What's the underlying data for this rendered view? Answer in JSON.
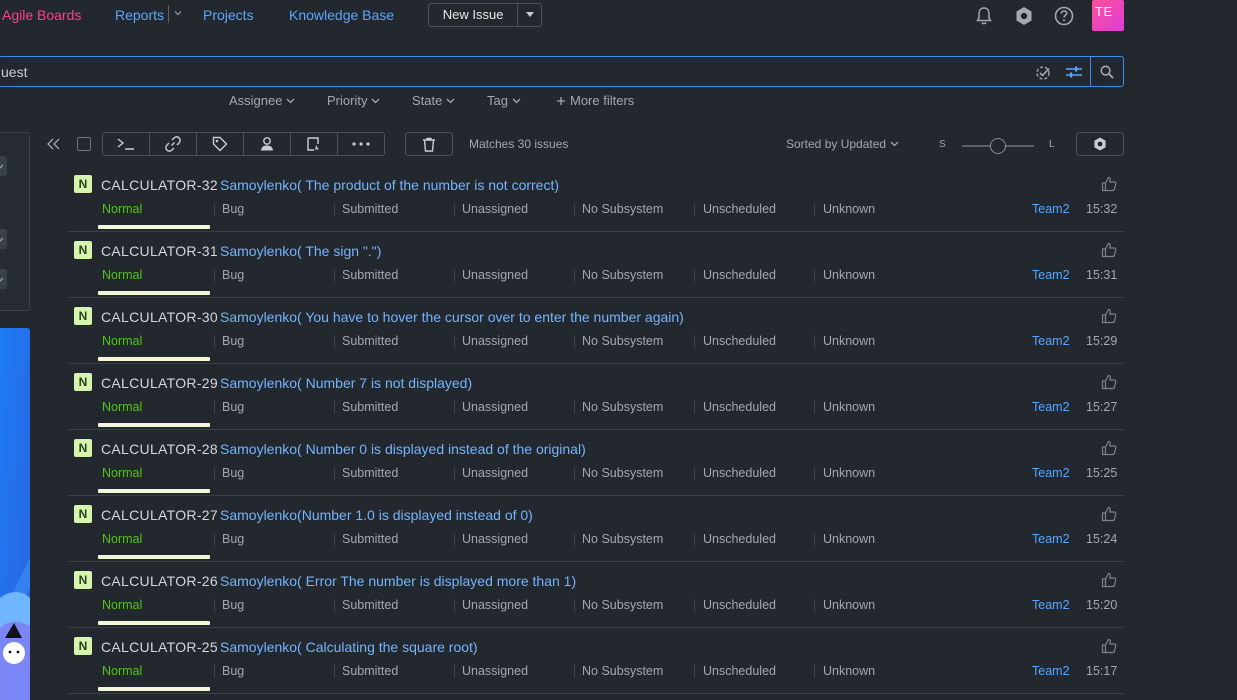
{
  "nav": {
    "agile_boards": "Agile Boards",
    "reports": "Reports",
    "projects": "Projects",
    "knowledge_base": "Knowledge Base",
    "new_issue": "New Issue",
    "avatar_initials": "TE"
  },
  "search": {
    "query_text": "uest"
  },
  "filters": {
    "assignee": "Assignee",
    "priority": "Priority",
    "state": "State",
    "tag": "Tag",
    "more": "More filters"
  },
  "toolbar": {
    "matches": "Matches 30 issues",
    "sorted": "Sorted by Updated",
    "size_small": "S",
    "size_large": "L"
  },
  "colors": {
    "accent_blue": "#58a7ff",
    "active_nav": "#ff3f8a",
    "priority_normal": "#52c41a",
    "badge_bg": "#d8f5b0"
  },
  "issues": [
    {
      "badge": "N",
      "id": "CALCULATOR-32",
      "summary": "Samoylenko( The product of the number is not correct)",
      "priority": "Normal",
      "type": "Bug",
      "state": "Submitted",
      "assignee": "Unassigned",
      "subsystem": "No Subsystem",
      "fix_version": "Unscheduled",
      "affected": "Unknown",
      "team": "Team2",
      "time": "15:32"
    },
    {
      "badge": "N",
      "id": "CALCULATOR-31",
      "summary": "Samoylenko( The sign \".\")",
      "priority": "Normal",
      "type": "Bug",
      "state": "Submitted",
      "assignee": "Unassigned",
      "subsystem": "No Subsystem",
      "fix_version": "Unscheduled",
      "affected": "Unknown",
      "team": "Team2",
      "time": "15:31"
    },
    {
      "badge": "N",
      "id": "CALCULATOR-30",
      "summary": "Samoylenko( You have to hover the cursor over to enter the number again)",
      "priority": "Normal",
      "type": "Bug",
      "state": "Submitted",
      "assignee": "Unassigned",
      "subsystem": "No Subsystem",
      "fix_version": "Unscheduled",
      "affected": "Unknown",
      "team": "Team2",
      "time": "15:29"
    },
    {
      "badge": "N",
      "id": "CALCULATOR-29",
      "summary": "Samoylenko( Number 7 is not displayed)",
      "priority": "Normal",
      "type": "Bug",
      "state": "Submitted",
      "assignee": "Unassigned",
      "subsystem": "No Subsystem",
      "fix_version": "Unscheduled",
      "affected": "Unknown",
      "team": "Team2",
      "time": "15:27"
    },
    {
      "badge": "N",
      "id": "CALCULATOR-28",
      "summary": "Samoylenko( Number 0 is displayed instead of the original)",
      "priority": "Normal",
      "type": "Bug",
      "state": "Submitted",
      "assignee": "Unassigned",
      "subsystem": "No Subsystem",
      "fix_version": "Unscheduled",
      "affected": "Unknown",
      "team": "Team2",
      "time": "15:25"
    },
    {
      "badge": "N",
      "id": "CALCULATOR-27",
      "summary": "Samoylenko(Number 1.0 is displayed instead of 0)",
      "priority": "Normal",
      "type": "Bug",
      "state": "Submitted",
      "assignee": "Unassigned",
      "subsystem": "No Subsystem",
      "fix_version": "Unscheduled",
      "affected": "Unknown",
      "team": "Team2",
      "time": "15:24"
    },
    {
      "badge": "N",
      "id": "CALCULATOR-26",
      "summary": "Samoylenko( Error The number is displayed more than 1)",
      "priority": "Normal",
      "type": "Bug",
      "state": "Submitted",
      "assignee": "Unassigned",
      "subsystem": "No Subsystem",
      "fix_version": "Unscheduled",
      "affected": "Unknown",
      "team": "Team2",
      "time": "15:20"
    },
    {
      "badge": "N",
      "id": "CALCULATOR-25",
      "summary": "Samoylenko( Calculating the square root)",
      "priority": "Normal",
      "type": "Bug",
      "state": "Submitted",
      "assignee": "Unassigned",
      "subsystem": "No Subsystem",
      "fix_version": "Unscheduled",
      "affected": "Unknown",
      "team": "Team2",
      "time": "15:17"
    }
  ]
}
